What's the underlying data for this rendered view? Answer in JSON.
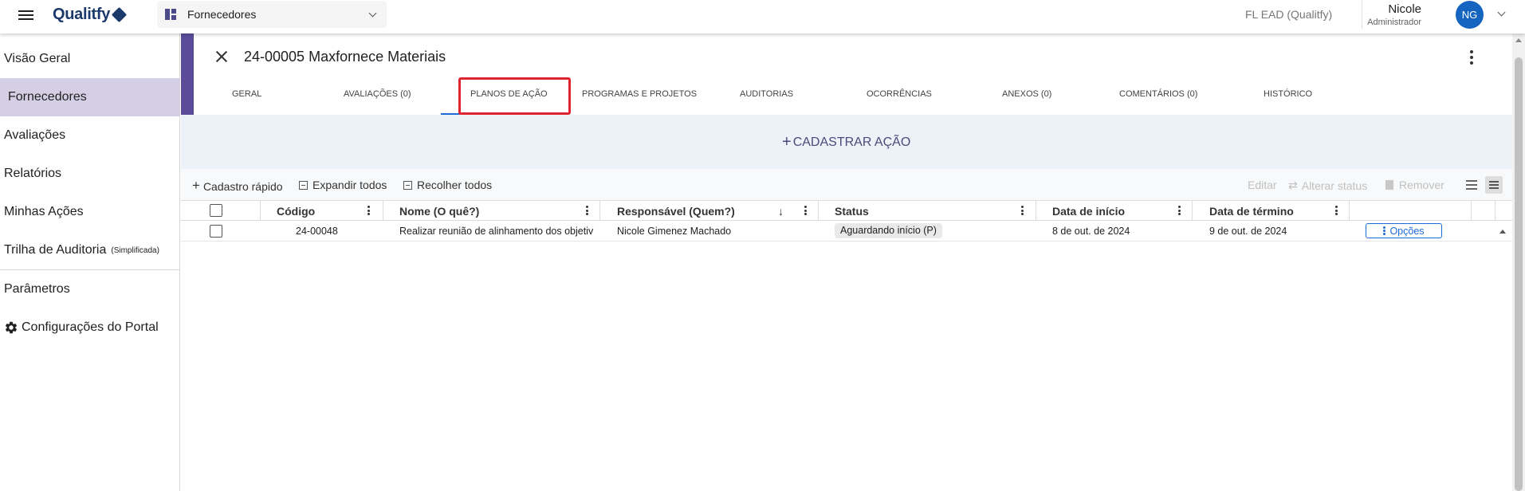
{
  "topbar": {
    "logo": "Qualitfy",
    "module": "Fornecedores",
    "company": "FL EAD (Qualitfy)",
    "user_name": "Nicole",
    "user_role": "Administrador",
    "avatar_initials": "NG"
  },
  "sidebar": {
    "items": [
      {
        "label": "Visão Geral"
      },
      {
        "label": "Fornecedores",
        "active": true
      },
      {
        "label": "Avaliações"
      },
      {
        "label": "Relatórios"
      },
      {
        "label": "Minhas Ações"
      },
      {
        "label": "Trilha de Auditoria",
        "suffix": "(Simplificada)"
      },
      {
        "label": "Parâmetros"
      },
      {
        "label": "Configurações do Portal"
      }
    ]
  },
  "record": {
    "title": "24-00005 Maxfornece Materiais"
  },
  "tabs": [
    {
      "label": "GERAL"
    },
    {
      "label": "AVALIAÇÕES (0)"
    },
    {
      "label": "PLANOS DE AÇÃO",
      "active": true
    },
    {
      "label": "PROGRAMAS E PROJETOS"
    },
    {
      "label": "AUDITORIAS"
    },
    {
      "label": "OCORRÊNCIAS"
    },
    {
      "label": "ANEXOS (0)"
    },
    {
      "label": "COMENTÁRIOS (0)"
    },
    {
      "label": "HISTÓRICO"
    }
  ],
  "cta": {
    "label": "CADASTRAR AÇÃO"
  },
  "toolbar": {
    "quick": "Cadastro rápido",
    "expand": "Expandir todos",
    "collapse": "Recolher todos",
    "edit": "Editar",
    "change_status": "Alterar status",
    "remove": "Remover"
  },
  "table": {
    "columns": [
      "Código",
      "Nome (O quê?)",
      "Responsável (Quem?)",
      "Status",
      "Data de início",
      "Data de término"
    ],
    "rows": [
      {
        "code": "24-00048",
        "name": "Realizar reunião de alinhamento dos objetiv",
        "responsible": "Nicole Gimenez Machado",
        "status": "Aguardando início (P)",
        "start": "8 de out. de 2024",
        "end": "9 de out. de 2024",
        "action": "Opções"
      }
    ]
  },
  "colors": {
    "accent": "#5b4c9a",
    "sidebar_active": "#d5cfe6",
    "highlight": "#e0252f",
    "link": "#1e6ad6"
  }
}
